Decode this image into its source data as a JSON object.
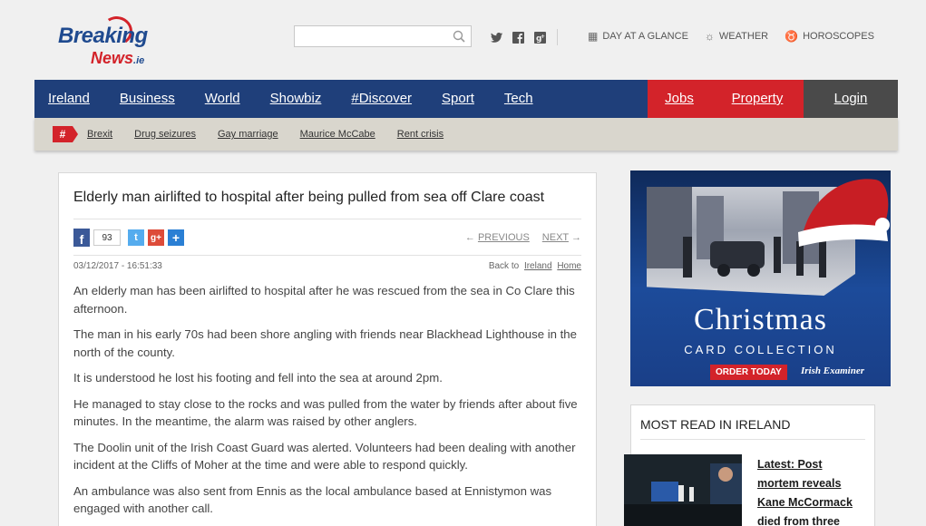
{
  "header": {
    "logo_top": "Breaking",
    "logo_bottom": "News",
    "logo_tld": ".ie",
    "search_placeholder": "",
    "social": [
      {
        "icon": "twitter-icon",
        "glyph": "𝕥"
      },
      {
        "icon": "facebook-icon",
        "glyph": "f"
      },
      {
        "icon": "google-plus-icon",
        "glyph": "g"
      }
    ],
    "links": [
      {
        "icon": "calendar-icon",
        "glyph": "▦",
        "label": "DAY AT A GLANCE"
      },
      {
        "icon": "weather-icon",
        "glyph": "☼",
        "label": "WEATHER"
      },
      {
        "icon": "horoscope-icon",
        "glyph": "♉",
        "label": "HOROSCOPES"
      }
    ]
  },
  "nav": {
    "items": [
      "Ireland",
      "Business",
      "World",
      "Showbiz",
      "#Discover",
      "Sport",
      "Tech"
    ],
    "jobs": "Jobs",
    "property": "Property",
    "login": "Login",
    "colors": {
      "primary": "#1f3f7a",
      "accent": "#d3232a",
      "login": "#4a4a4a"
    }
  },
  "trending": {
    "hash": "#",
    "items": [
      "Brexit",
      "Drug seizures",
      "Gay marriage",
      "Maurice McCabe",
      "Rent crisis"
    ]
  },
  "article": {
    "headline": "Elderly man airlifted to hospital after being pulled from sea off Clare coast",
    "share_count": "93",
    "previous": "PREVIOUS",
    "next": "NEXT",
    "timestamp": "03/12/2017 - 16:51:33",
    "back_to": "Back to",
    "back_section": "Ireland",
    "back_home": "Home",
    "paragraphs": [
      "An elderly man has been airlifted to hospital after he was rescued from the sea in Co Clare this afternoon.",
      "The man in his early 70s had been shore angling with friends near Blackhead Lighthouse in the north of the county.",
      "It is understood he lost his footing and fell into the sea at around 2pm.",
      "He managed to stay close to the rocks and was pulled from the water by friends after about five minutes. In the meantime, the alarm was raised by other anglers.",
      "The Doolin unit of the Irish Coast Guard was alerted. Volunteers had been dealing with another incident at the Cliffs of Moher at the time and were able to respond quickly.",
      "An ambulance was also sent from Ennis as the local ambulance based at Ennistymon was engaged with another call."
    ]
  },
  "ad": {
    "title": "Christmas",
    "subtitle": "CARD COLLECTION",
    "button": "ORDER TODAY",
    "brand": "Irish Examiner"
  },
  "most_read": {
    "title": "MOST READ IN IRELAND",
    "story": "Latest: Post mortem reveals Kane McCormack died from three"
  }
}
